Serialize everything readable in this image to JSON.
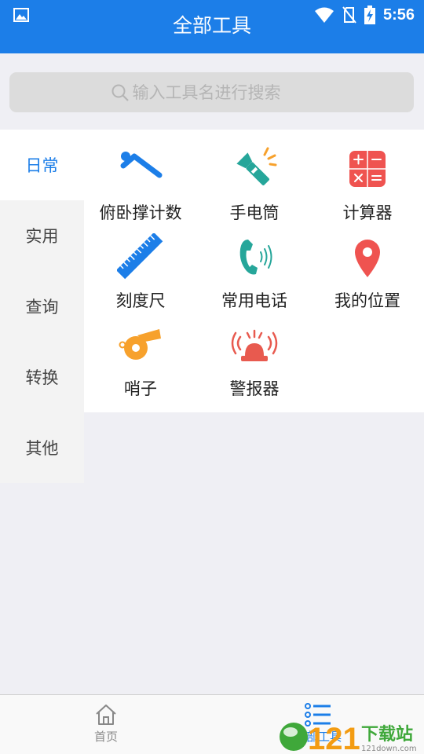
{
  "status_bar": {
    "time": "5:56"
  },
  "header": {
    "title": "全部工具"
  },
  "search": {
    "placeholder": "输入工具名进行搜索"
  },
  "sidebar": {
    "items": [
      {
        "label": "日常",
        "active": true
      },
      {
        "label": "实用",
        "active": false
      },
      {
        "label": "查询",
        "active": false
      },
      {
        "label": "转换",
        "active": false
      },
      {
        "label": "其他",
        "active": false
      }
    ]
  },
  "tools": [
    {
      "label": "俯卧撑计数",
      "icon": "pushup-icon"
    },
    {
      "label": "手电筒",
      "icon": "flashlight-icon"
    },
    {
      "label": "计算器",
      "icon": "calculator-icon"
    },
    {
      "label": "刻度尺",
      "icon": "ruler-icon"
    },
    {
      "label": "常用电话",
      "icon": "phone-icon"
    },
    {
      "label": "我的位置",
      "icon": "location-pin-icon"
    },
    {
      "label": "哨子",
      "icon": "whistle-icon"
    },
    {
      "label": "警报器",
      "icon": "alarm-siren-icon"
    }
  ],
  "bottom_nav": {
    "tabs": [
      {
        "label": "首页",
        "icon": "home-icon",
        "active": false
      },
      {
        "label": "全部工具",
        "icon": "list-icon",
        "active": true
      }
    ]
  },
  "watermark": {
    "text": "121下载站",
    "subtext": "121down.com"
  },
  "colors": {
    "primary": "#1c7ee8",
    "background": "#efeff4",
    "sidebar_bg": "#f3f3f3",
    "calculator_red": "#ef5350",
    "phone_teal": "#26a69a",
    "whistle_orange": "#f7a12c",
    "siren_red": "#e85a4f"
  }
}
